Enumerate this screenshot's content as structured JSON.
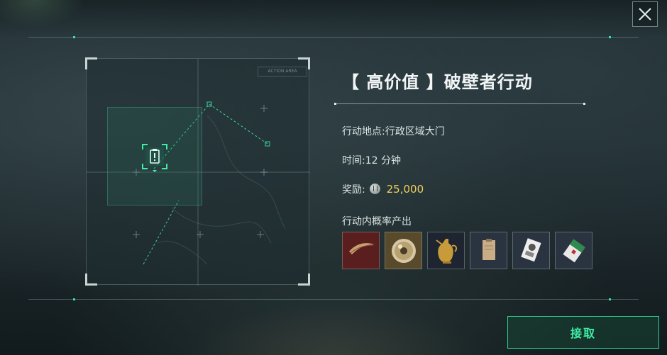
{
  "header": {
    "close_icon": "close-icon"
  },
  "map": {
    "label": "ACTION AREA"
  },
  "mission": {
    "title": "【 高价值 】破壁者行动",
    "location_label": "行动地点:",
    "location_value": "行政区域大门",
    "time_label": "时间:",
    "time_value": "12 分钟",
    "reward_label": "奖励:",
    "reward_icon": "coin-icon",
    "reward_value": "25,000",
    "drops_label": "行动内概率产出"
  },
  "drops": [
    {
      "name": "feather-item",
      "bg": "#5a1e1e"
    },
    {
      "name": "disc-item",
      "bg": "#5a4a2c"
    },
    {
      "name": "golden-ewer-item",
      "bg": "#1e2430"
    },
    {
      "name": "document-item",
      "bg": "#2a3440"
    },
    {
      "name": "card-item",
      "bg": "#2a3440"
    },
    {
      "name": "cigarette-pack-item",
      "bg": "#2a3440"
    }
  ],
  "actions": {
    "accept_label": "接取"
  },
  "colors": {
    "accent": "#2ee6a0",
    "reward": "#f2cf5b"
  }
}
